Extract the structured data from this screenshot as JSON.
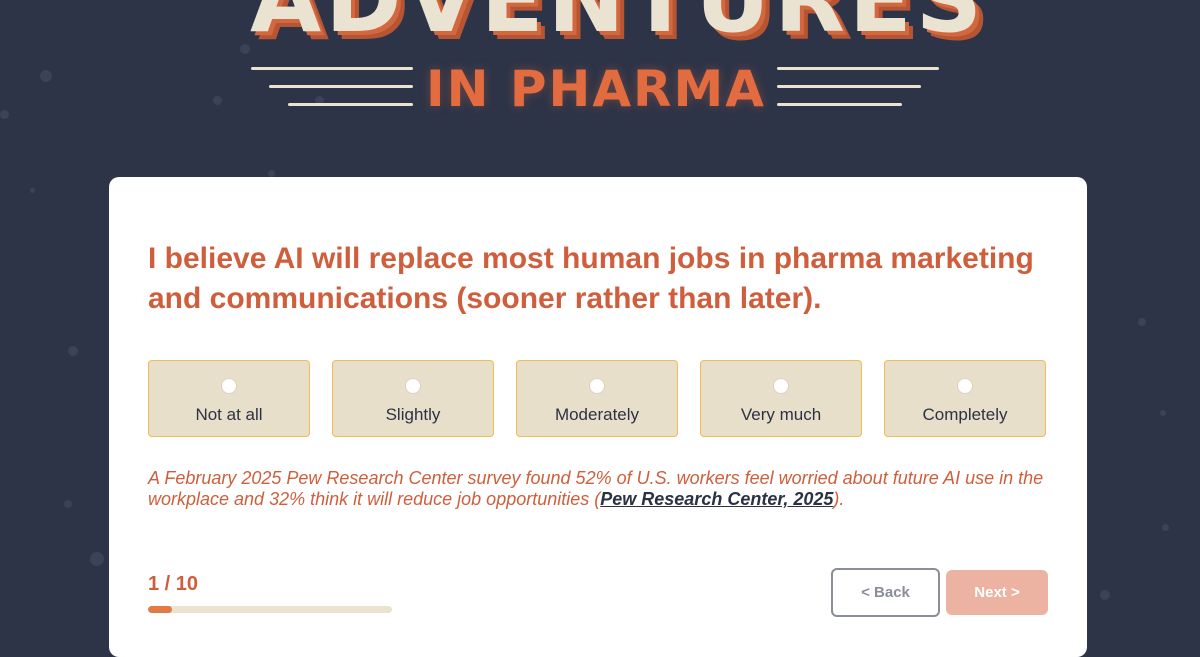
{
  "logo": {
    "title": "ADVENTURES",
    "subtitle": "IN PHARMA"
  },
  "question": {
    "text": "I believe AI will replace most human jobs in pharma marketing and communications (sooner rather than later)."
  },
  "options": [
    {
      "label": "Not at all",
      "selected": false
    },
    {
      "label": "Slightly",
      "selected": false
    },
    {
      "label": "Moderately",
      "selected": false
    },
    {
      "label": "Very much",
      "selected": false
    },
    {
      "label": "Completely",
      "selected": false
    }
  ],
  "note": {
    "text": "A February 2025 Pew Research Center survey found 52% of U.S. workers feel worried about future AI use in the workplace and 32% think it will reduce job opportunities (",
    "link_text": "Pew Research Center, 2025",
    "text_end": ")."
  },
  "progress": {
    "label": "1 / 10",
    "fraction": 0.1
  },
  "nav": {
    "back_label": "< Back",
    "next_label": "Next >"
  },
  "colors": {
    "background": "#2d3447",
    "accent": "#cf5f3c",
    "option_bg": "#e8dfcb",
    "option_border": "#f0bd52",
    "next_button": "#ecb3a2"
  }
}
